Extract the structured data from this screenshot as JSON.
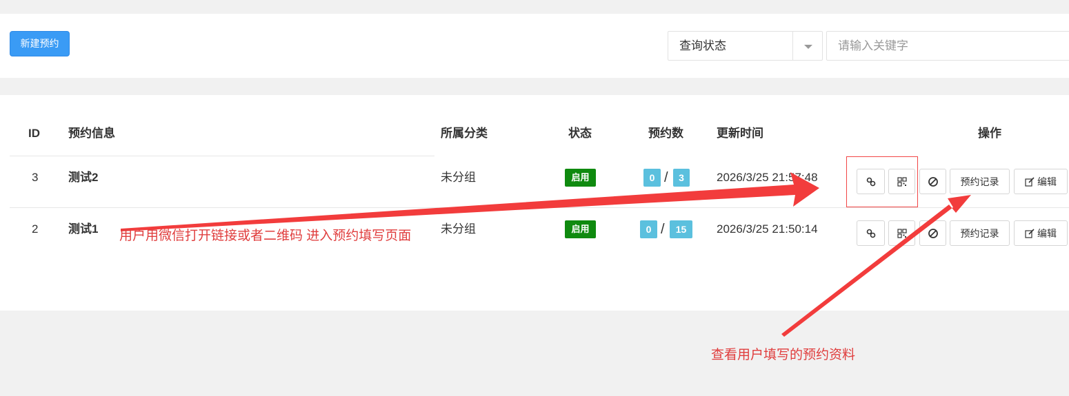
{
  "toolbar": {
    "new_button": "新建预约",
    "status_select": "查询状态",
    "search_placeholder": "请输入关键字"
  },
  "table": {
    "headers": {
      "id": "ID",
      "info": "预约信息",
      "category": "所属分类",
      "status": "状态",
      "count": "预约数",
      "updated": "更新时间",
      "actions": "操作"
    },
    "rows": [
      {
        "id": "3",
        "name": "测试2",
        "category": "未分组",
        "status": "启用",
        "booked": "0",
        "total": "3",
        "updated": "2026/3/25 21:57:48"
      },
      {
        "id": "2",
        "name": "测试1",
        "category": "未分组",
        "status": "启用",
        "booked": "0",
        "total": "15",
        "updated": "2026/3/25 21:50:14"
      }
    ],
    "slash": "/",
    "action_labels": {
      "records": "预约记录",
      "edit": "编辑"
    }
  },
  "annotations": {
    "link_qr_note": "用户用微信打开链接或者二维码 进入预约填写页面",
    "records_note": "查看用户填写的预约资料",
    "color": "#e03d3d"
  },
  "colors": {
    "primary": "#3a9bf5",
    "status_green": "#0f8a0f",
    "count_badge": "#5bc0de"
  }
}
